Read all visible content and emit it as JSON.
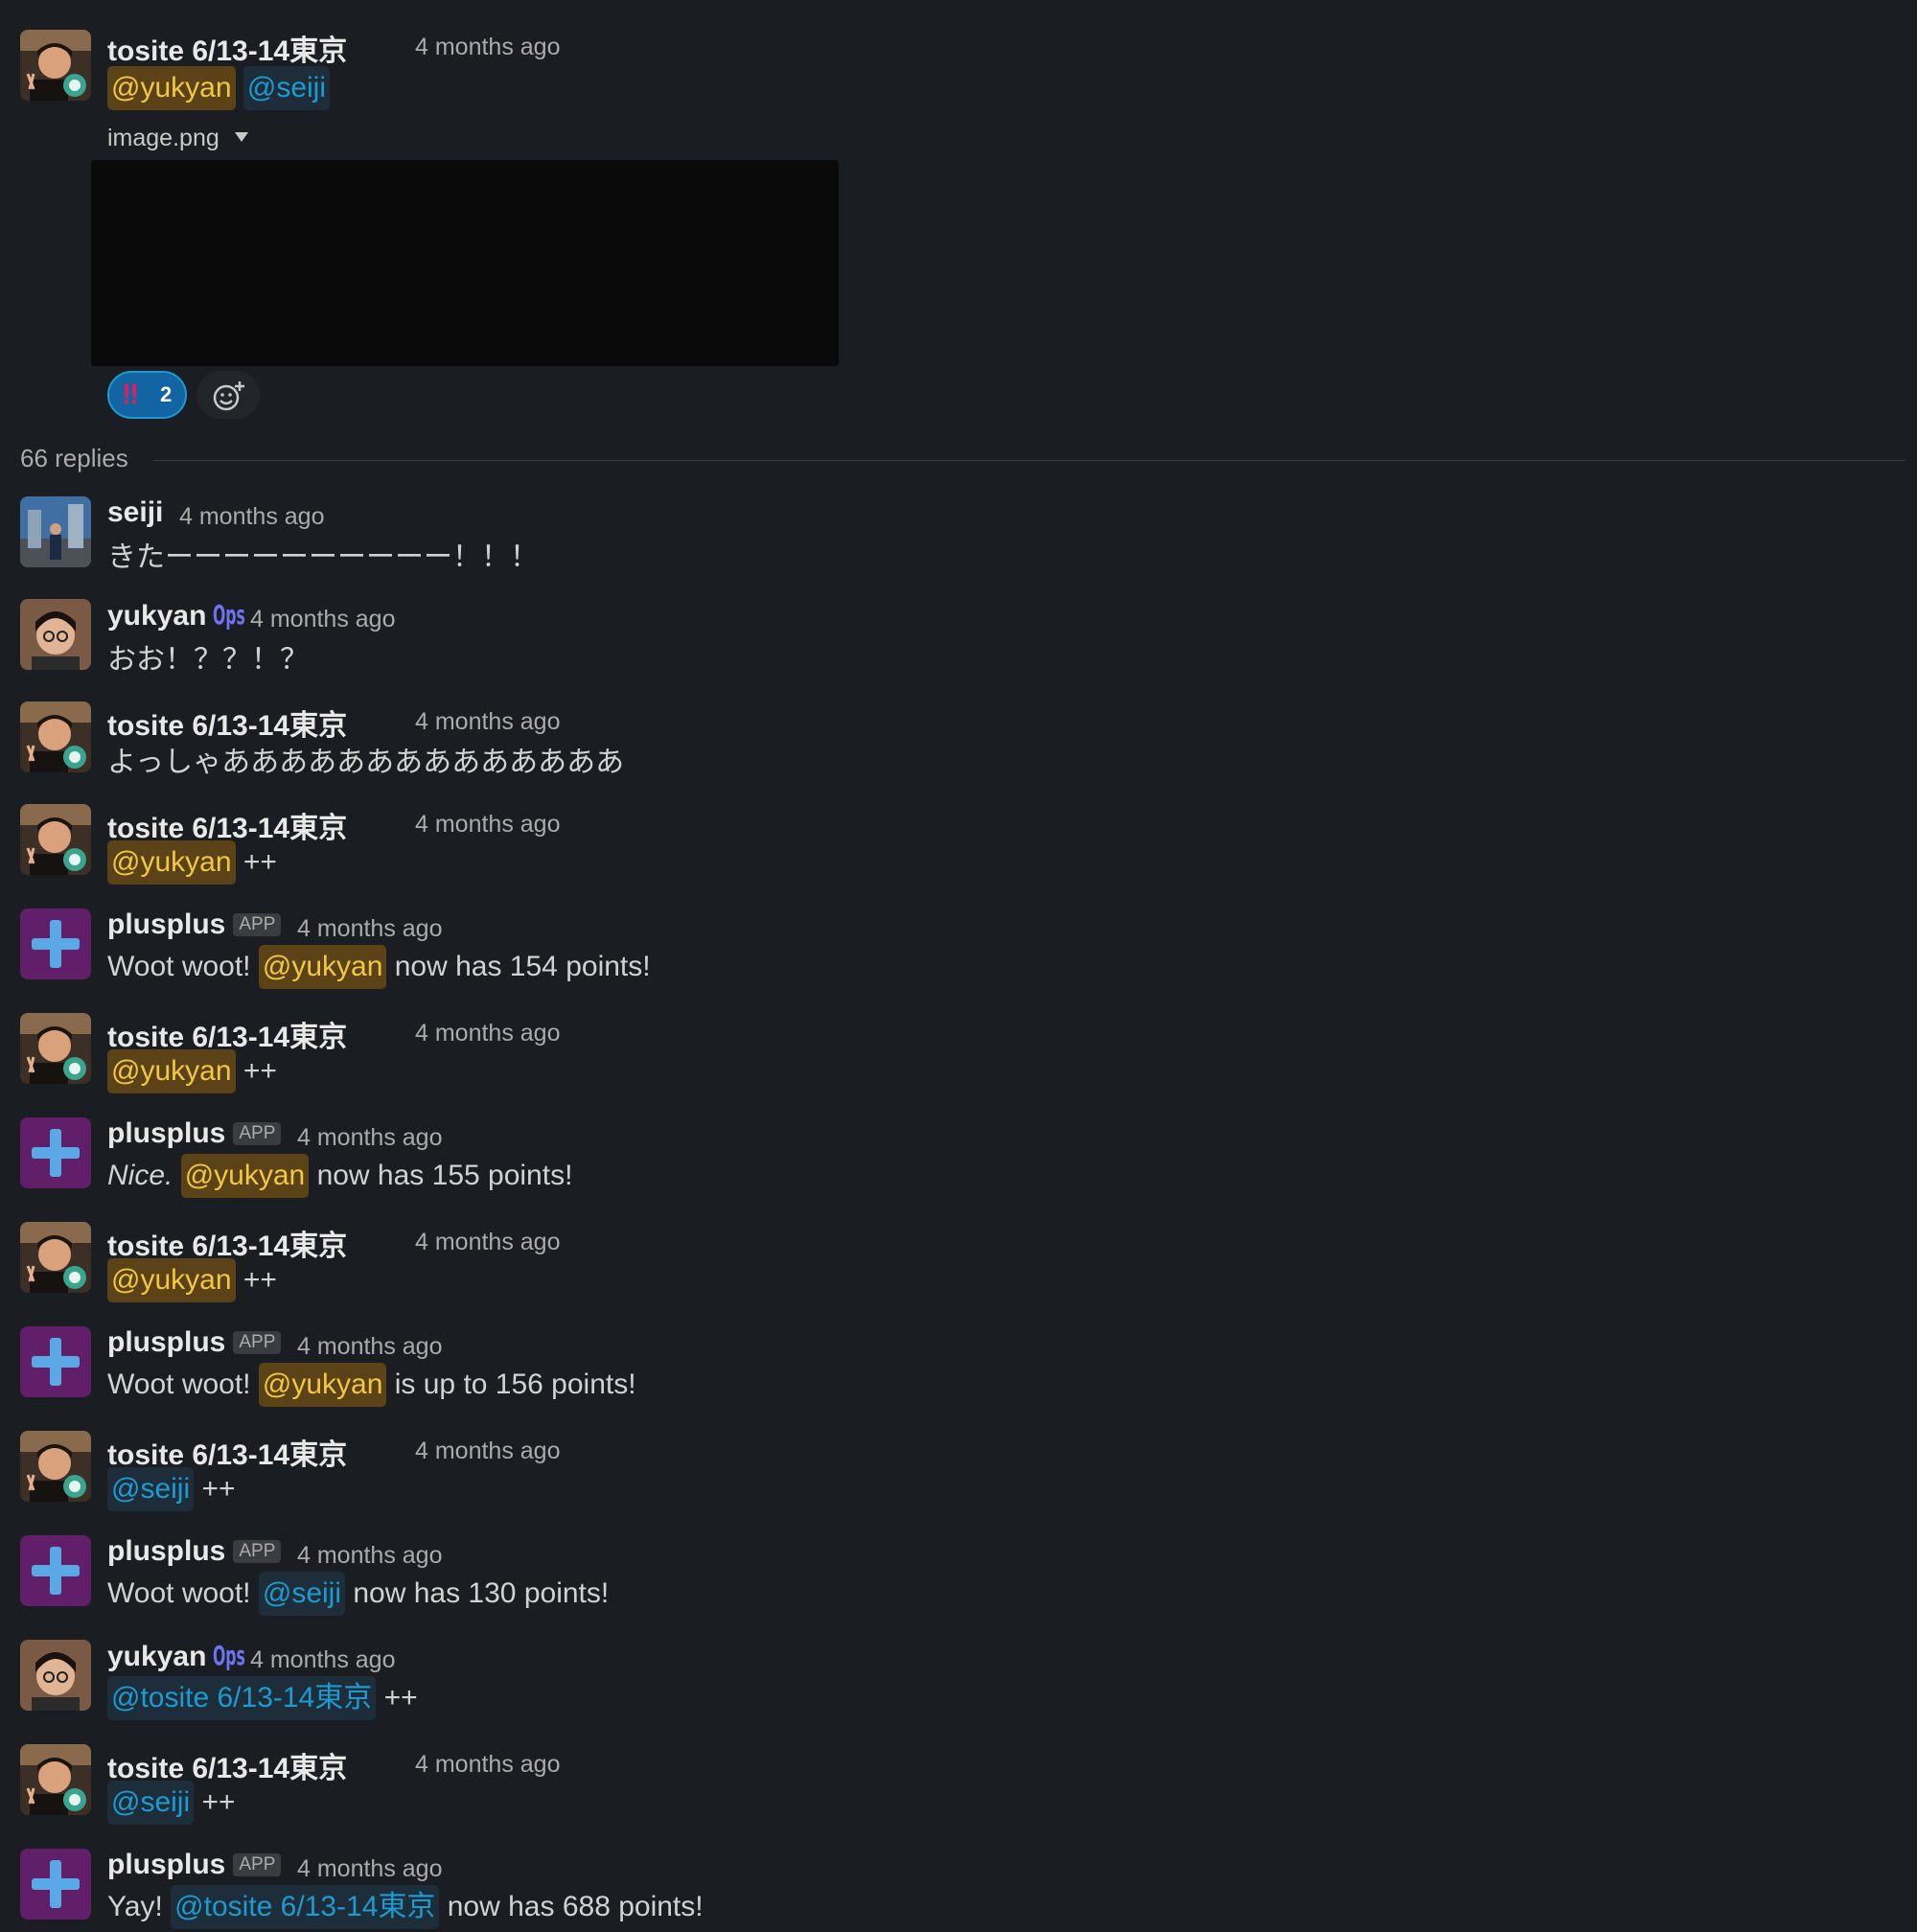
{
  "parent": {
    "author": "tosite 6/13-14東京",
    "timestamp": "4 months ago",
    "mentions": [
      "@yukyan",
      "@seiji"
    ],
    "file_name": "image.png",
    "reaction": {
      "emoji": "‼",
      "count": "2"
    }
  },
  "replies_count": "66 replies",
  "replies": [
    {
      "author": "seiji",
      "timestamp": "4 months ago",
      "text": "きたーーーーーーーーーー！！！"
    },
    {
      "author": "yukyan",
      "badge": "Ops",
      "timestamp": "4 months ago",
      "text": "おお！？？！？"
    },
    {
      "author": "tosite 6/13-14東京",
      "timestamp": "4 months ago",
      "text": "よっしゃああああああああああああああ"
    },
    {
      "author": "tosite 6/13-14東京",
      "timestamp": "4 months ago",
      "mention": "@yukyan",
      "suffix": "++"
    },
    {
      "author": "plusplus",
      "badge": "APP",
      "timestamp": "4 months ago",
      "prefix": "Woot woot!",
      "mention": "@yukyan",
      "suffix": "now has 154 points!"
    },
    {
      "author": "tosite 6/13-14東京",
      "timestamp": "4 months ago",
      "mention": "@yukyan",
      "suffix": "++"
    },
    {
      "author": "plusplus",
      "badge": "APP",
      "timestamp": "4 months ago",
      "prefix": "Nice.",
      "mention": "@yukyan",
      "suffix": "now has 155 points!"
    },
    {
      "author": "tosite 6/13-14東京",
      "timestamp": "4 months ago",
      "mention": "@yukyan",
      "suffix": "++"
    },
    {
      "author": "plusplus",
      "badge": "APP",
      "timestamp": "4 months ago",
      "prefix": "Woot woot!",
      "mention": "@yukyan",
      "suffix": "is up to 156 points!"
    },
    {
      "author": "tosite 6/13-14東京",
      "timestamp": "4 months ago",
      "mention": "@seiji",
      "suffix": "++"
    },
    {
      "author": "plusplus",
      "badge": "APP",
      "timestamp": "4 months ago",
      "prefix": "Woot woot!",
      "mention": "@seiji",
      "suffix": "now has 130 points!"
    },
    {
      "author": "yukyan",
      "badge": "Ops",
      "timestamp": "4 months ago",
      "mention": "@tosite 6/13-14東京",
      "suffix": "++"
    },
    {
      "author": "tosite 6/13-14東京",
      "timestamp": "4 months ago",
      "mention": "@seiji",
      "suffix": "++"
    },
    {
      "author": "plusplus",
      "badge": "APP",
      "timestamp": "4 months ago",
      "prefix": "Yay!",
      "mention": "@tosite 6/13-14東京",
      "suffix": "now has 688 points!"
    }
  ],
  "colors": {
    "background": "#1a1d21",
    "mention_self_bg": "#5b4217",
    "mention_self_text": "#f2c744",
    "mention_other_text": "#1d9bd1",
    "plusplus_avatar": "#611f69",
    "plusplus_cross": "#5aa9e6"
  },
  "icons": {
    "add_reaction": "emoji-add-icon",
    "file_toggle": "caret-down-icon"
  }
}
